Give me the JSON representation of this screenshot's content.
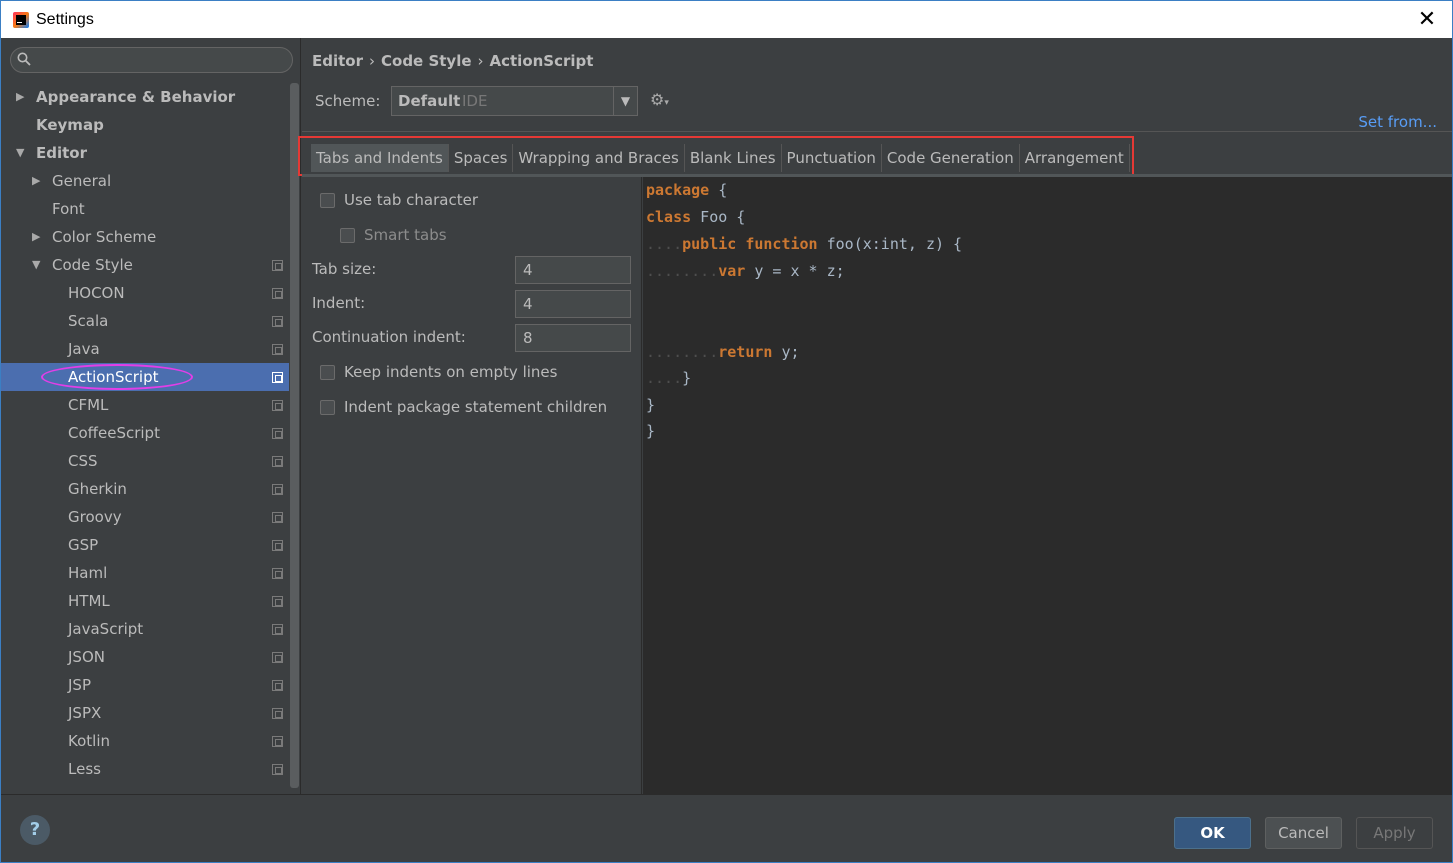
{
  "window": {
    "title": "Settings",
    "close_icon": "close-icon"
  },
  "search": {
    "placeholder": "",
    "icon": "search-icon"
  },
  "tree": {
    "appearance": "Appearance & Behavior",
    "keymap": "Keymap",
    "editor": "Editor",
    "general": "General",
    "font": "Font",
    "color_scheme": "Color Scheme",
    "code_style": "Code Style",
    "languages": [
      "HOCON",
      "Scala",
      "Java",
      "ActionScript",
      "CFML",
      "CoffeeScript",
      "CSS",
      "Gherkin",
      "Groovy",
      "GSP",
      "Haml",
      "HTML",
      "JavaScript",
      "JSON",
      "JSP",
      "JSPX",
      "Kotlin",
      "Less"
    ],
    "selected": "ActionScript"
  },
  "breadcrumb": {
    "part1": "Editor",
    "part2": "Code Style",
    "part3": "ActionScript",
    "separator": "›"
  },
  "scheme": {
    "label": "Scheme:",
    "value": "Default",
    "sub": "IDE",
    "dropdown_icon": "chevron-down-icon"
  },
  "set_from": "Set from...",
  "tabs": [
    "Tabs and Indents",
    "Spaces",
    "Wrapping and Braces",
    "Blank Lines",
    "Punctuation",
    "Code Generation",
    "Arrangement"
  ],
  "options": {
    "use_tab_character": "Use tab character",
    "smart_tabs": "Smart tabs",
    "tab_size_label": "Tab size:",
    "tab_size": "4",
    "indent_label": "Indent:",
    "indent": "4",
    "continuation_label": "Continuation indent:",
    "continuation": "8",
    "keep_indents": "Keep indents on empty lines",
    "indent_package": "Indent package statement children"
  },
  "code": {
    "l1_kw": "package",
    "l1_rest": " {",
    "l2_kw": "class",
    "l2_rest": " Foo {",
    "l3_dots": "....",
    "l3_kw1": "public",
    "l3_sp": " ",
    "l3_kw2": "function",
    "l3_rest": " foo(x:int, z) {",
    "l4_dots": "........",
    "l4_kw": "var",
    "l4_rest": " y = x * z;",
    "l5_dots": "........",
    "l5_kw": "return",
    "l5_rest": " y;",
    "l6_dots": "....",
    "l6_rest": "}",
    "l7_rest": "}",
    "l8_rest": "}"
  },
  "buttons": {
    "ok": "OK",
    "cancel": "Cancel",
    "apply": "Apply",
    "help": "?"
  }
}
